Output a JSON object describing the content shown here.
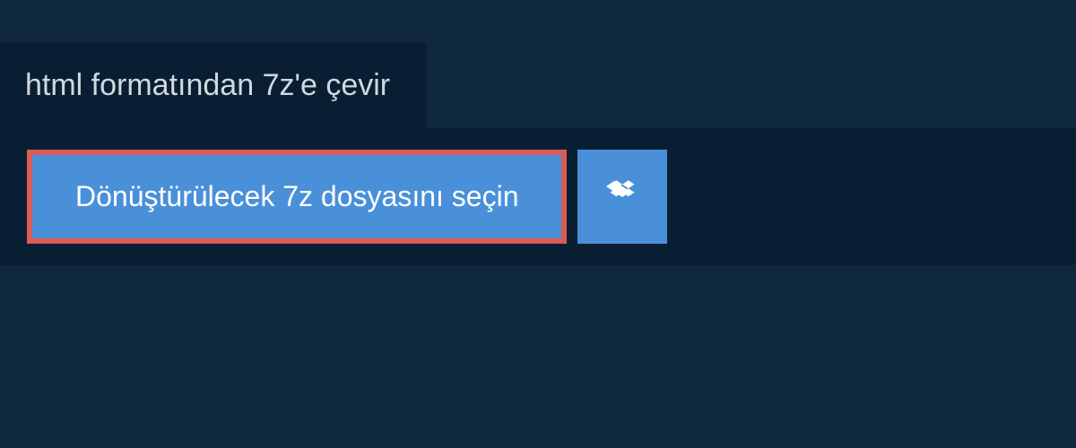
{
  "header": {
    "title": "html formatından 7z'e çevir"
  },
  "upload": {
    "select_file_label": "Dönüştürülecek 7z dosyasını seçin"
  }
}
